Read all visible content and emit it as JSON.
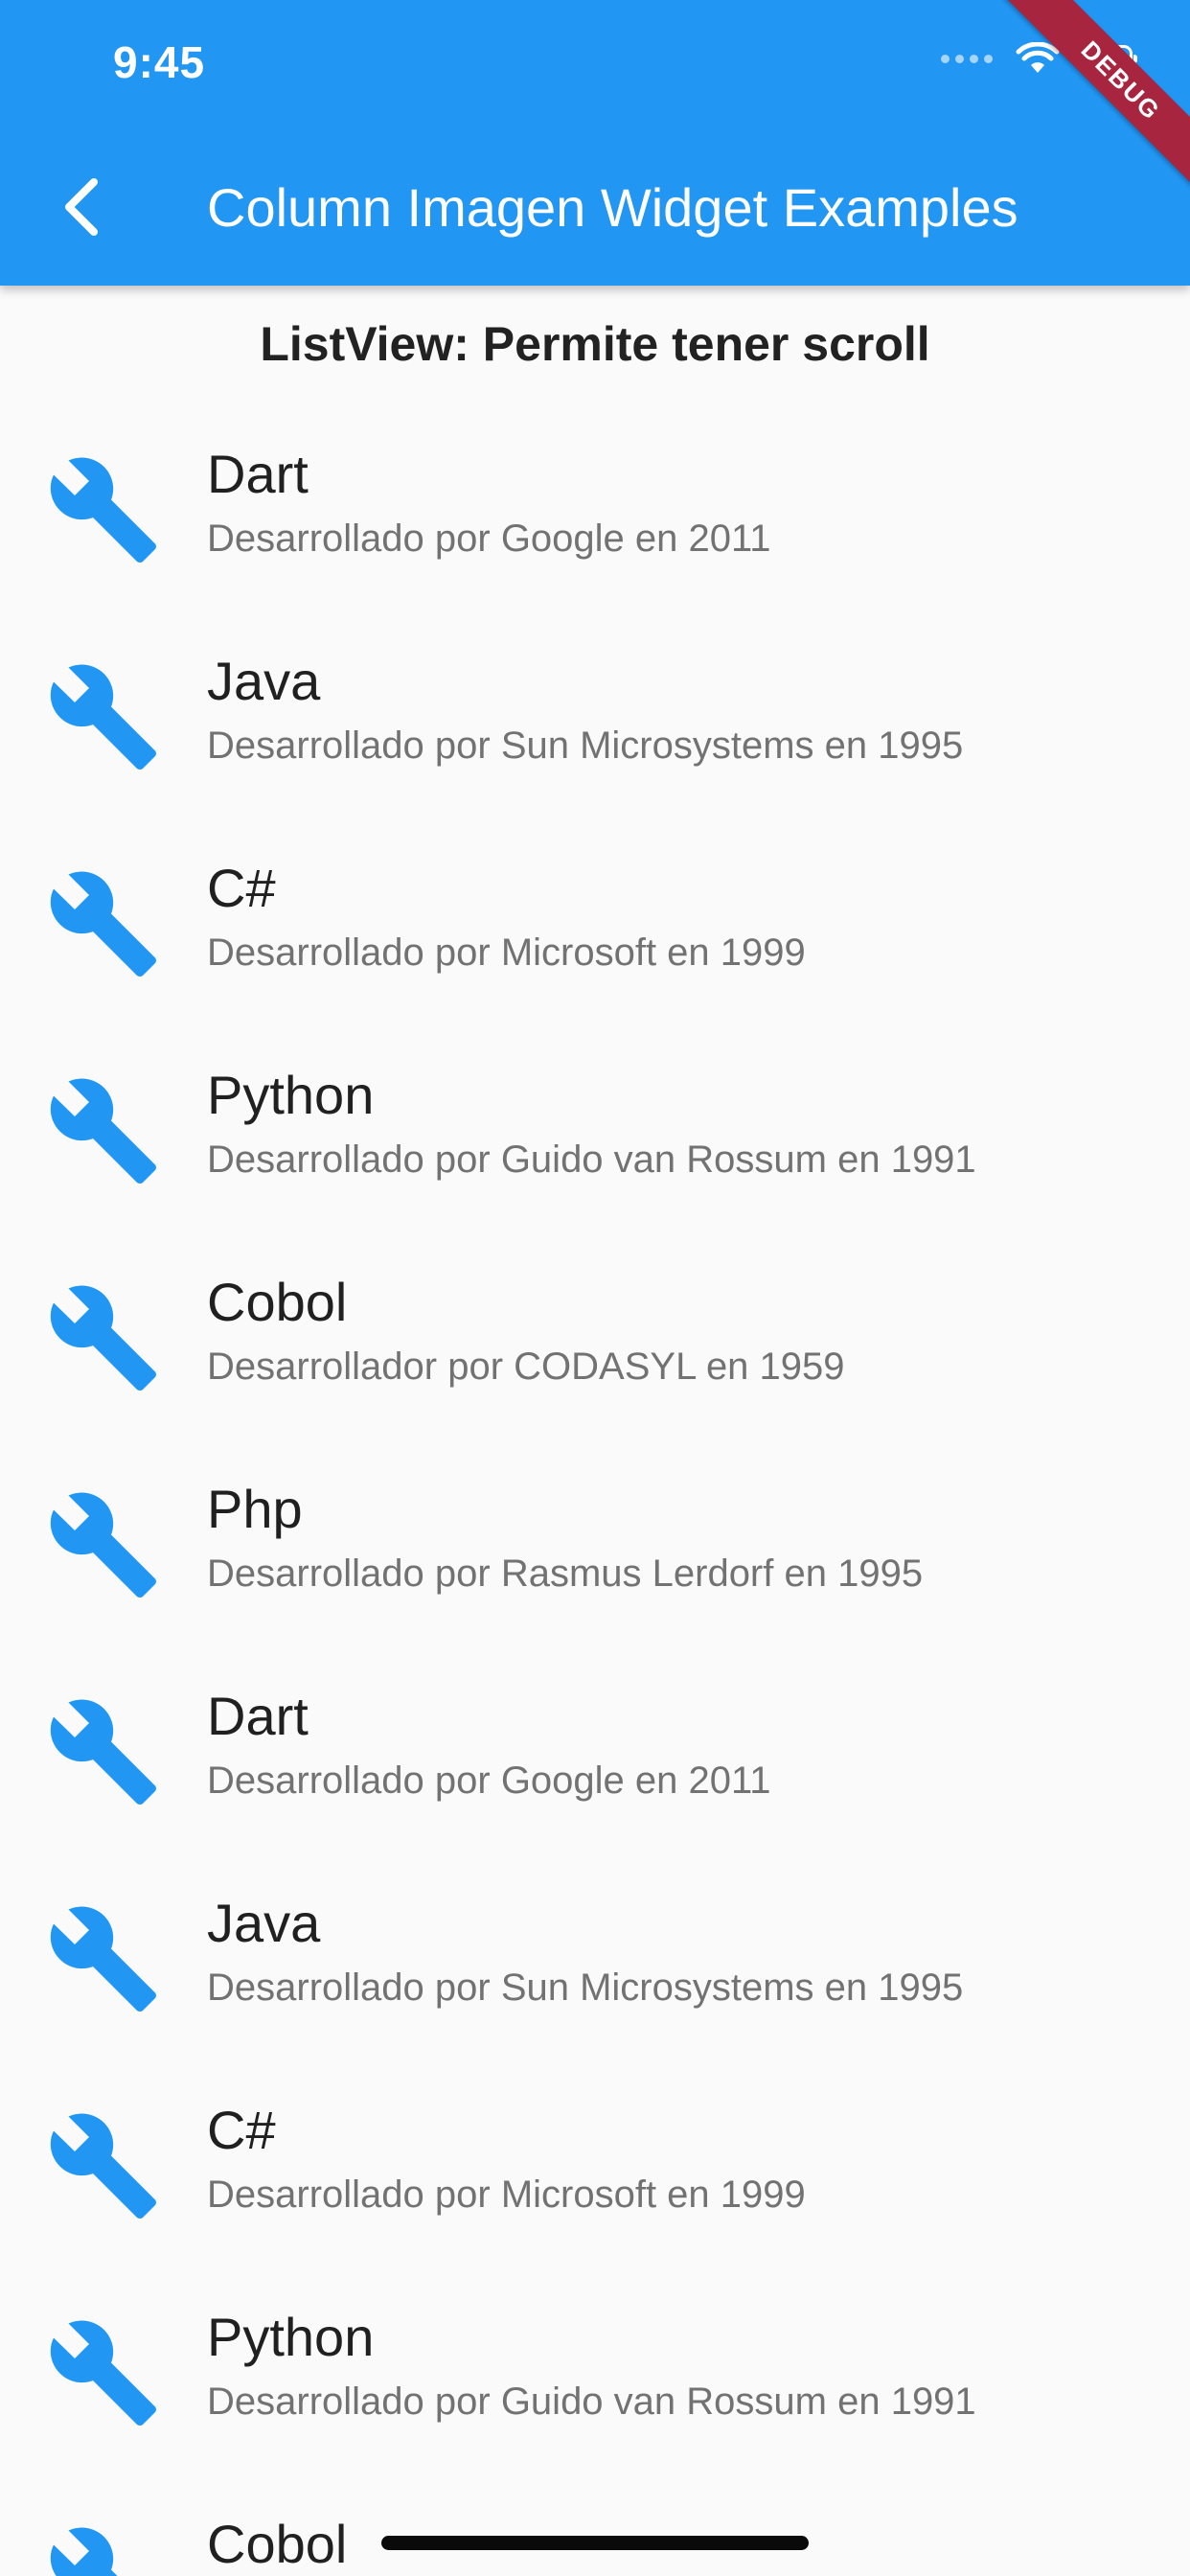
{
  "status_bar": {
    "time": "9:45"
  },
  "app_bar": {
    "title": "Column Imagen Widget Examples",
    "back_icon": "chevron-left-icon",
    "background_color": "#2196f3"
  },
  "debug_banner": {
    "label": "DEBUG"
  },
  "section": {
    "title": "ListView: Permite tener scroll"
  },
  "list": {
    "icon": "wrench-icon",
    "icon_color": "#2196f3",
    "items": [
      {
        "title": "Dart",
        "subtitle": "Desarrollado por Google en 2011"
      },
      {
        "title": "Java",
        "subtitle": "Desarrollado por Sun Microsystems en 1995"
      },
      {
        "title": "C#",
        "subtitle": "Desarrollado por Microsoft en 1999"
      },
      {
        "title": "Python",
        "subtitle": "Desarrollado por Guido van Rossum en 1991"
      },
      {
        "title": "Cobol",
        "subtitle": "Desarrollador por CODASYL en 1959"
      },
      {
        "title": "Php",
        "subtitle": "Desarrollado por Rasmus Lerdorf en 1995"
      },
      {
        "title": "Dart",
        "subtitle": "Desarrollado por Google en 2011"
      },
      {
        "title": "Java",
        "subtitle": "Desarrollado por Sun Microsystems en 1995"
      },
      {
        "title": "C#",
        "subtitle": "Desarrollado por Microsoft en 1999"
      },
      {
        "title": "Python",
        "subtitle": "Desarrollado por Guido van Rossum en 1991"
      },
      {
        "title": "Cobol",
        "subtitle": ""
      }
    ]
  }
}
